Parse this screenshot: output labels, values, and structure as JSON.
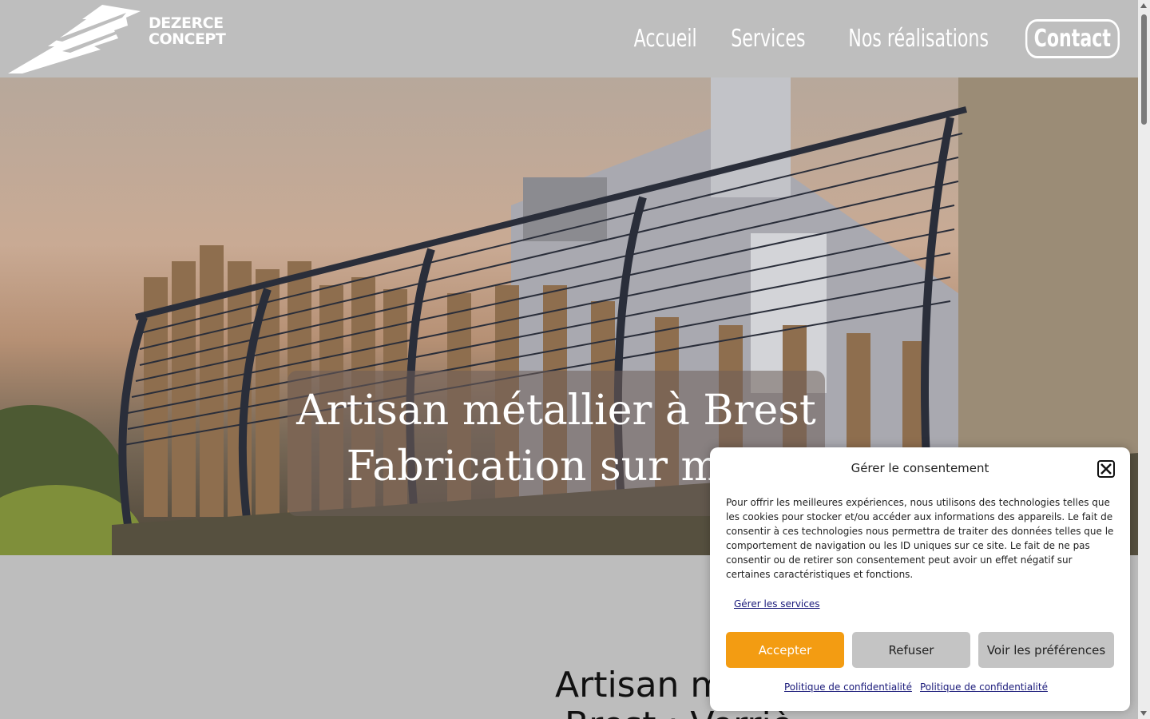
{
  "header": {
    "logo_text_line1": "DEZERCE",
    "logo_text_line2": "CONCEPT",
    "nav": [
      "Accueil",
      "Services",
      "Nos réalisations"
    ],
    "contact": "Contact"
  },
  "hero": {
    "line1": "Artisan métallier à Brest",
    "line2": "Fabrication sur mes"
  },
  "content": {
    "title": "Artisan m",
    "subtitle": "Brest : Verriè"
  },
  "consent": {
    "title": "Gérer le consentement",
    "text": "Pour offrir les meilleures expériences, nous utilisons des technologies telles que les cookies pour stocker et/ou accéder aux informations des appareils. Le fait de consentir à ces technologies nous permettra de traiter des données telles que le comportement de navigation ou les ID uniques sur ce site. Le fait de ne pas consentir ou de retirer son consentement peut avoir un effet négatif sur certaines caractéristiques et fonctions.",
    "manage_services": "Gérer les services",
    "accept": "Accepter",
    "refuse": "Refuser",
    "preferences": "Voir les préférences",
    "policy1": "Politique de confidentialité",
    "policy2": "Politique de confidentialité"
  },
  "colors": {
    "accent": "#f39c12",
    "header_bg": "#bebebe"
  }
}
